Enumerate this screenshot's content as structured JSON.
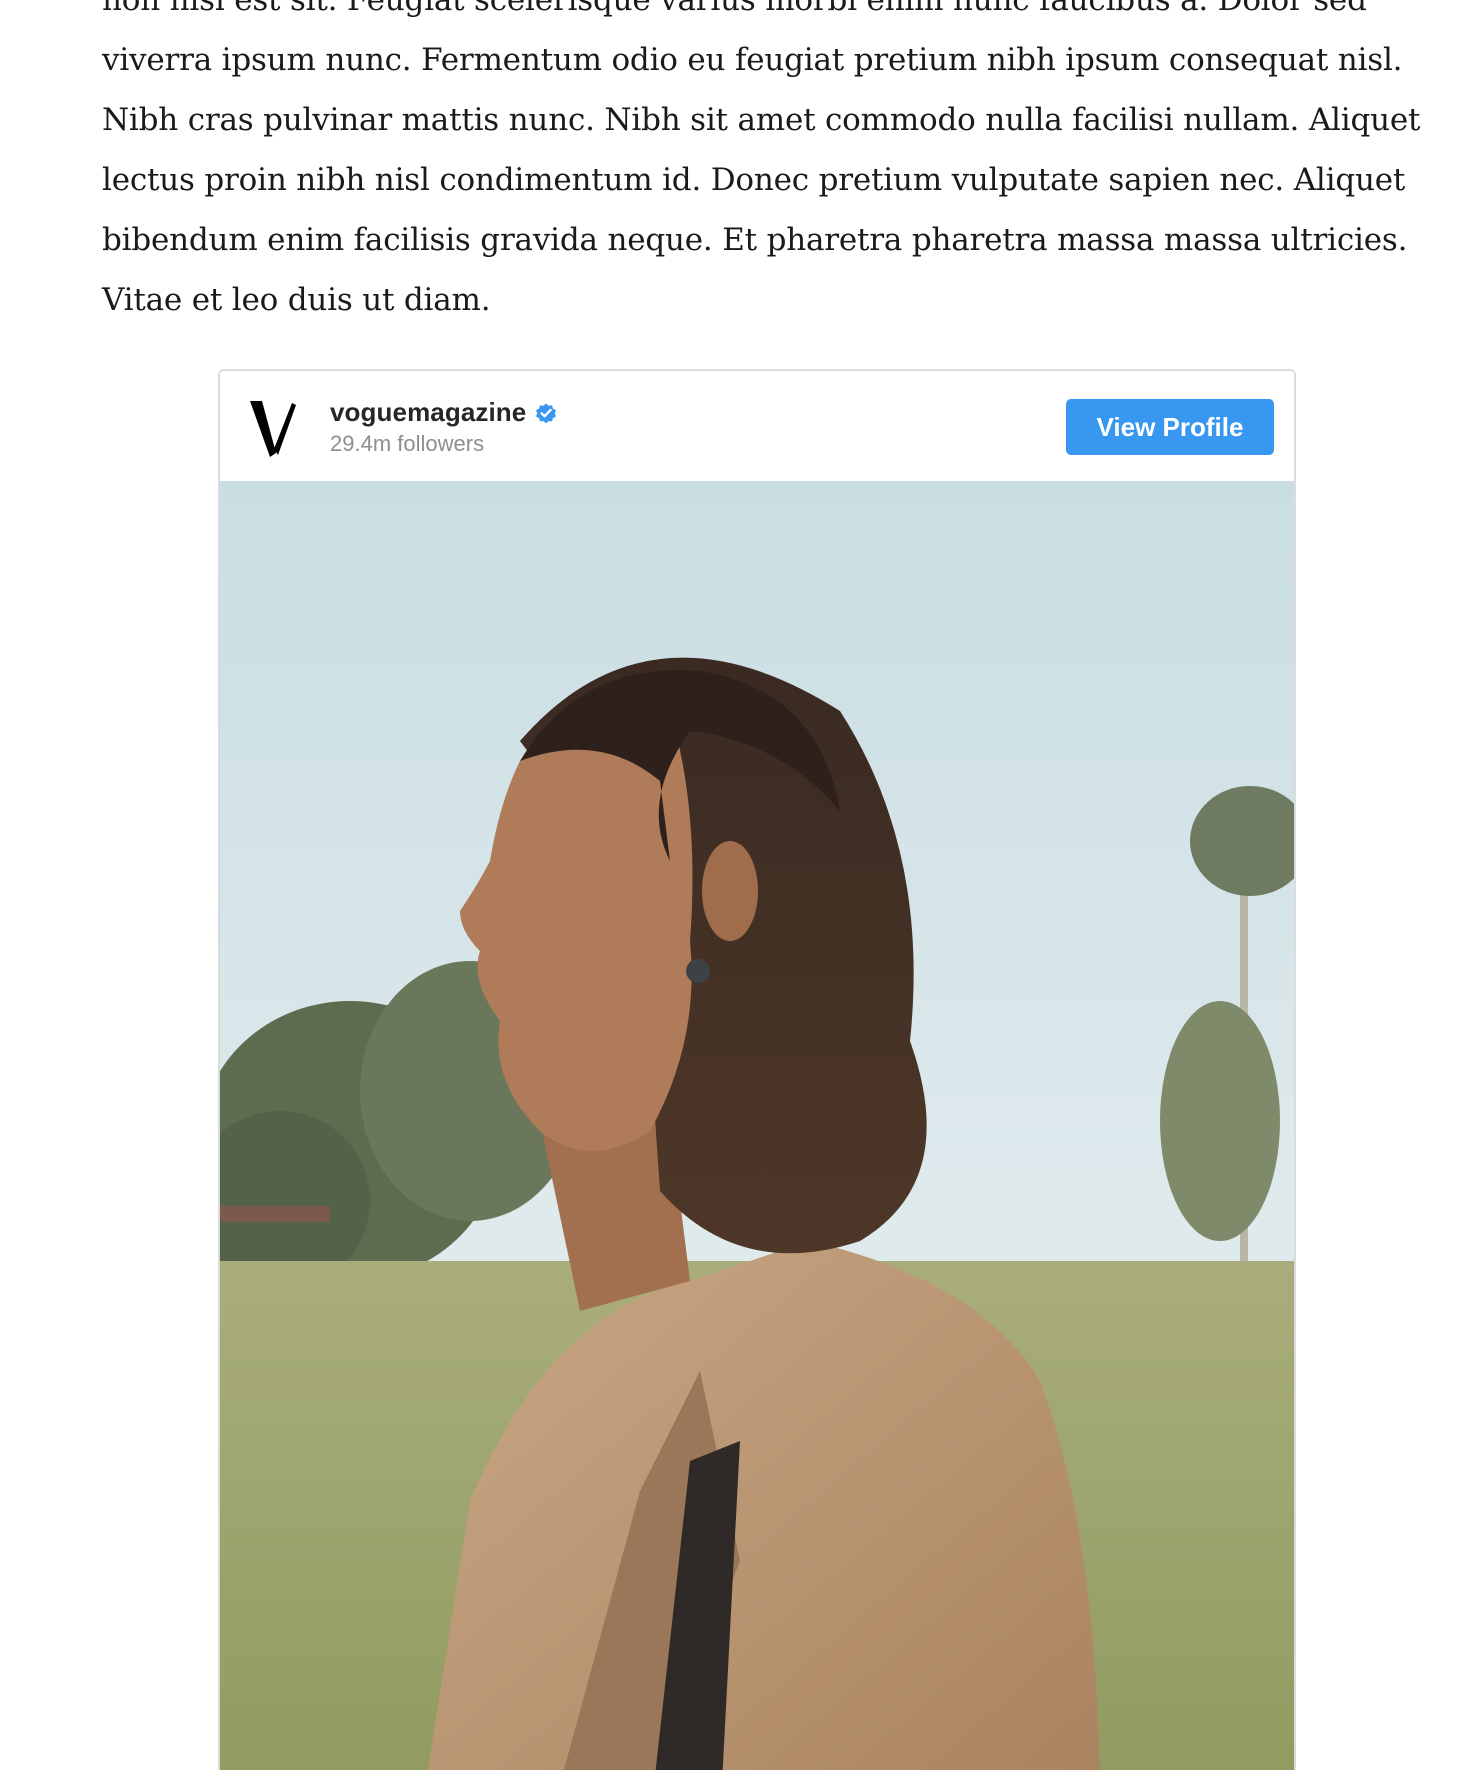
{
  "article": {
    "lines": [
      "non nisi est sit. Feugiat scelerisque varius morbi enim nunc faucibus a. Dolor sed",
      "viverra ipsum nunc. Fermentum odio eu feugiat pretium nibh ipsum consequat nisl.",
      "Nibh cras pulvinar mattis nunc. Nibh sit amet commodo nulla facilisi nullam. Aliquet",
      "lectus proin nibh nisl condimentum id. Donec pretium vulputate sapien nec. Aliquet",
      "bibendum enim facilisis gravida neque. Et pharetra pharetra massa massa ultricies.",
      "Vitae et leo duis ut diam."
    ]
  },
  "embed": {
    "profile": {
      "username": "voguemagazine",
      "verified": true,
      "followers": "29.4m followers",
      "avatar_icon": "vogue-v-logo-icon"
    },
    "view_profile_label": "View Profile",
    "accent_color": "#3897f0",
    "image": {
      "description_icon": "portrait-photo"
    }
  }
}
